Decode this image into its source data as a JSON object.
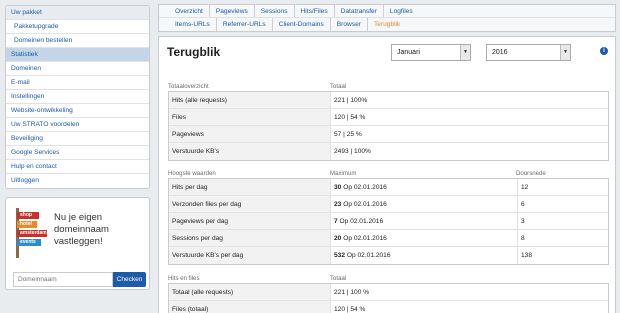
{
  "sidebar": {
    "items": [
      {
        "label": "Uw pakket",
        "kind": "head"
      },
      {
        "label": "Pakketupgrade",
        "kind": "sub"
      },
      {
        "label": "Domeinen bestellen",
        "kind": "sub"
      },
      {
        "label": "Statistiek",
        "kind": "active"
      },
      {
        "label": "Domeinen",
        "kind": "item"
      },
      {
        "label": "E-mail",
        "kind": "item"
      },
      {
        "label": "Instellingen",
        "kind": "item"
      },
      {
        "label": "Website-ontwikkeling",
        "kind": "item"
      },
      {
        "label": "Uw STRATO voordelen",
        "kind": "item"
      },
      {
        "label": "Beveiliging",
        "kind": "item"
      },
      {
        "label": "Google Services",
        "kind": "item"
      },
      {
        "label": "Hulp en contact",
        "kind": "item"
      },
      {
        "label": "Uitloggen",
        "kind": "item"
      }
    ],
    "promo": {
      "signs": [
        "shop",
        "hotel",
        "amsterdam",
        "events"
      ],
      "text": "Nu je eigen domeinnaam vastleggen!",
      "input_placeholder": "Domeinnaam",
      "button": "Checken"
    }
  },
  "tabs": {
    "row1": [
      "Overzicht",
      "Pageviews",
      "Sessions",
      "Hits/Files",
      "Datatransfer",
      "Logfiles"
    ],
    "row2": [
      "Items-URLs",
      "Referrer-URLs",
      "Client-Domains",
      "Browser",
      "Terugblik"
    ],
    "active": "Terugblik"
  },
  "content": {
    "title": "Terugblik",
    "month": "Januari",
    "year": "2016",
    "overview": {
      "head_label": "Totaaloverzicht",
      "head_total": "Totaal",
      "rows": [
        {
          "label": "Hits (alle requests)",
          "value": "221 | 100%"
        },
        {
          "label": "Files",
          "value": "120 | 54 %"
        },
        {
          "label": "Pageviews",
          "value": "57 | 25 %"
        },
        {
          "label": "Verstuurde KB's",
          "value": "2493 | 100%"
        }
      ]
    },
    "peaks": {
      "head_label": "Hoogste waarden",
      "head_max": "Maximum",
      "head_avg": "Doorsnede",
      "rows": [
        {
          "label": "Hits per dag",
          "max": "30",
          "date": "Op 02.01.2016",
          "avg": "12"
        },
        {
          "label": "Verzonden files per dag",
          "max": "23",
          "date": "Op 02.01.2016",
          "avg": "6"
        },
        {
          "label": "Pageviews per dag",
          "max": "7",
          "date": "Op 02.01.2016",
          "avg": "3"
        },
        {
          "label": "Sessions per dag",
          "max": "20",
          "date": "Op 02.01.2016",
          "avg": "8"
        },
        {
          "label": "Verstuurde KB's per dag",
          "max": "532",
          "date": "Op 02.01.2016",
          "avg": "138"
        }
      ]
    },
    "hits": {
      "head_label": "Hits en files",
      "head_total": "Totaal",
      "rows": [
        {
          "label": "Totaal (alle requests)",
          "value": "221 | 100 %"
        },
        {
          "label": "Files (totaal)",
          "value": "120 | 54 %"
        }
      ]
    }
  }
}
